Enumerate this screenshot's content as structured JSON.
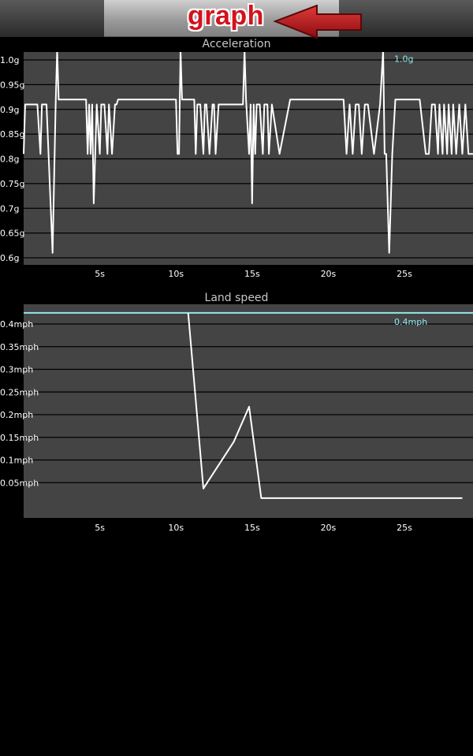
{
  "header": {
    "title": "graph",
    "title_color": "#d3121c",
    "arrow_color": "#c8151b"
  },
  "chart_data": [
    {
      "type": "line",
      "title": "Acceleration",
      "ylim": [
        0.6,
        1.0
      ],
      "xlim": [
        0,
        29.5
      ],
      "y_ticks": [
        0.6,
        0.65,
        0.7,
        0.75,
        0.8,
        0.85,
        0.9,
        0.95,
        1.0
      ],
      "y_tick_labels": [
        "0.6g",
        "0.65g",
        "0.7g",
        "0.75g",
        "0.8g",
        "0.85g",
        "0.9g",
        "0.95g",
        "1.0g"
      ],
      "x_ticks": [
        5,
        10,
        15,
        20,
        25
      ],
      "x_tick_labels": [
        "5s",
        "10s",
        "15s",
        "20s",
        "25s"
      ],
      "max_line": {
        "value": 1.02,
        "label": "1.0g",
        "color": "#8ee8ec"
      },
      "grid": true,
      "series": [
        {
          "color": "#ffffff",
          "x": [
            0,
            0.1,
            0.9,
            1.1,
            1.2,
            1.5,
            1.9,
            2.1,
            2.2,
            2.3,
            4.1,
            4.2,
            4.3,
            4.4,
            4.5,
            4.6,
            4.7,
            4.8,
            5.0,
            5.1,
            5.3,
            5.5,
            5.6,
            5.8,
            6.0,
            6.1,
            6.2,
            6.3,
            6.4,
            10.0,
            10.1,
            10.2,
            10.3,
            10.4,
            11.2,
            11.3,
            11.4,
            11.6,
            11.8,
            11.9,
            12.0,
            12.2,
            12.4,
            12.5,
            12.6,
            12.8,
            13.0,
            14.4,
            14.5,
            14.6,
            14.8,
            14.9,
            15.0,
            15.1,
            15.2,
            15.3,
            15.5,
            15.7,
            15.8,
            16.0,
            16.1,
            16.3,
            16.8,
            17.5,
            21.0,
            21.2,
            21.4,
            21.6,
            21.8,
            22.0,
            22.2,
            22.4,
            22.6,
            23.0,
            23.4,
            23.6,
            23.7,
            23.8,
            24.0,
            24.2,
            24.4,
            26.0,
            26.4,
            26.6,
            26.8,
            27.0,
            27.2,
            27.3,
            27.5,
            27.6,
            27.8,
            27.9,
            28.1,
            28.2,
            28.4,
            28.6,
            28.8,
            29.0,
            29.2,
            29.5
          ],
          "y": [
            0.81,
            0.91,
            0.91,
            0.81,
            0.91,
            0.91,
            0.61,
            0.91,
            1.02,
            0.92,
            0.92,
            0.81,
            0.91,
            0.81,
            0.91,
            0.71,
            0.81,
            0.91,
            0.81,
            0.91,
            0.91,
            0.81,
            0.91,
            0.81,
            0.91,
            0.91,
            0.92,
            0.92,
            0.92,
            0.92,
            0.81,
            0.81,
            1.02,
            0.92,
            0.92,
            0.81,
            0.91,
            0.91,
            0.81,
            0.91,
            0.91,
            0.81,
            0.91,
            0.91,
            0.81,
            0.91,
            0.91,
            0.91,
            1.02,
            0.92,
            0.81,
            0.91,
            0.71,
            0.91,
            0.81,
            0.91,
            0.91,
            0.81,
            0.91,
            0.91,
            0.81,
            0.91,
            0.81,
            0.92,
            0.92,
            0.81,
            0.91,
            0.81,
            0.91,
            0.91,
            0.81,
            0.91,
            0.91,
            0.81,
            0.91,
            1.02,
            0.81,
            0.81,
            0.61,
            0.81,
            0.92,
            0.92,
            0.81,
            0.81,
            0.91,
            0.91,
            0.81,
            0.91,
            0.81,
            0.91,
            0.81,
            0.91,
            0.81,
            0.91,
            0.81,
            0.91,
            0.81,
            0.91,
            0.81,
            0.81
          ]
        }
      ]
    },
    {
      "type": "line",
      "title": "Land speed",
      "ylim": [
        0,
        0.4
      ],
      "xlim": [
        0,
        29.5
      ],
      "y_ticks": [
        0.05,
        0.1,
        0.15,
        0.2,
        0.25,
        0.3,
        0.35,
        0.4
      ],
      "y_tick_labels": [
        "0.05mph",
        "0.1mph",
        "0.15mph",
        "0.2mph",
        "0.25mph",
        "0.3mph",
        "0.35mph",
        "0.4mph"
      ],
      "x_ticks": [
        5,
        10,
        15,
        20,
        25
      ],
      "x_tick_labels": [
        "5s",
        "10s",
        "15s",
        "20s",
        "25s"
      ],
      "max_line": {
        "value": 0.4246,
        "label": "0.4mph",
        "color": "#8ee8ec"
      },
      "grid": true,
      "series": [
        {
          "color": "#ffffff",
          "x": [
            10.8,
            11.8,
            13.8,
            14.8,
            15.6,
            28.8
          ],
          "y": [
            0.4246,
            0.037,
            0.1404,
            0.2175,
            0.0158,
            0.0158
          ]
        }
      ]
    }
  ]
}
